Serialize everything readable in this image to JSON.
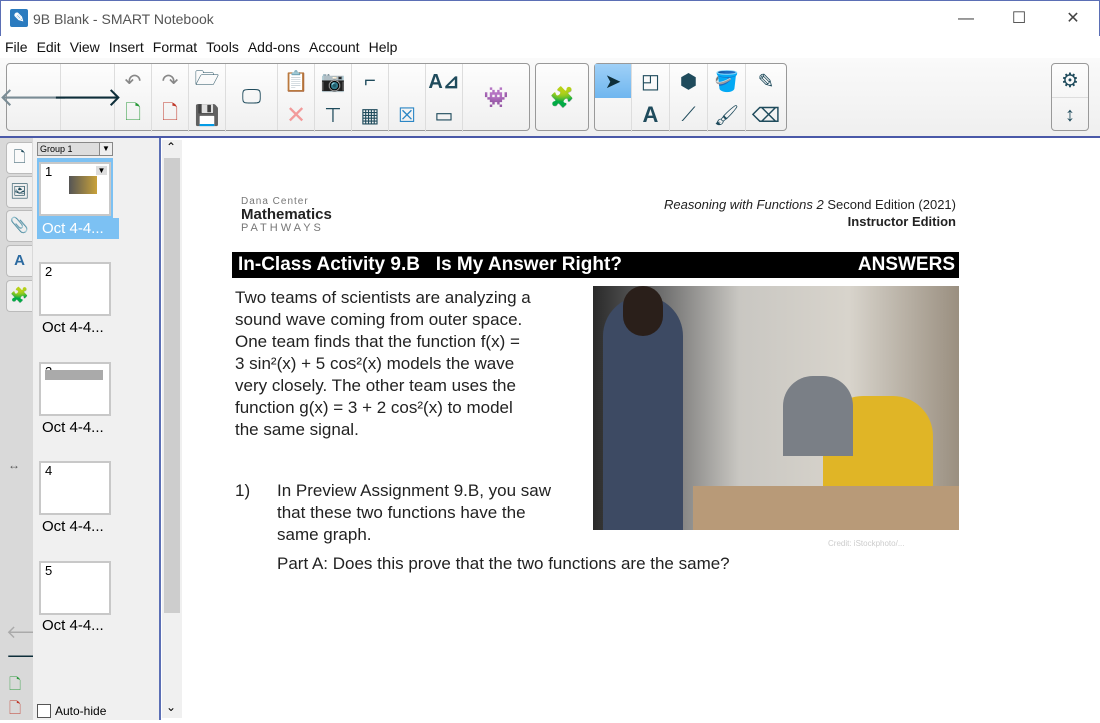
{
  "window": {
    "title": "9B Blank - SMART Notebook",
    "minimize": "—",
    "maximize": "☐",
    "close": "✕"
  },
  "menu": [
    "File",
    "Edit",
    "View",
    "Insert",
    "Format",
    "Tools",
    "Add-ons",
    "Account",
    "Help"
  ],
  "sorter": {
    "group": "Group 1",
    "pages": [
      {
        "num": "1",
        "label": "Oct 4-4..."
      },
      {
        "num": "2",
        "label": "Oct 4-4..."
      },
      {
        "num": "3",
        "label": "Oct 4-4..."
      },
      {
        "num": "4",
        "label": "Oct 4-4..."
      },
      {
        "num": "5",
        "label": "Oct 4-4..."
      }
    ],
    "autohide": "Auto-hide"
  },
  "page": {
    "logo": {
      "line1": "Dana Center",
      "line2": "Mathematics",
      "line3": "PATHWAYS"
    },
    "header_italic": "Reasoning with Functions 2",
    "header_rest": " Second Edition (2021)",
    "header_line2": "Instructor Edition",
    "banner_title": "In-Class Activity 9.B   Is My Answer Right?",
    "banner_right": "ANSWERS",
    "intro": [
      "Two teams of scientists are analyzing a",
      "sound wave coming from outer space.",
      "One team finds that the function f(x) =",
      "3 sin²(x) + 5 cos²(x) models the wave",
      "very closely. The other team uses the",
      "function g(x) = 3 + 2 cos²(x) to model",
      "the same signal."
    ],
    "q_num": "1)",
    "q_text": [
      "In Preview Assignment 9.B, you saw",
      "that these two functions have the",
      "same graph."
    ],
    "part_a": "Part A: Does this prove that the two functions are the same?",
    "credit": "Credit: iStockphoto/..."
  },
  "colors": {
    "accent": "#4a59a8",
    "selected": "#7cc1f3",
    "icon": "#1f4b5c"
  }
}
